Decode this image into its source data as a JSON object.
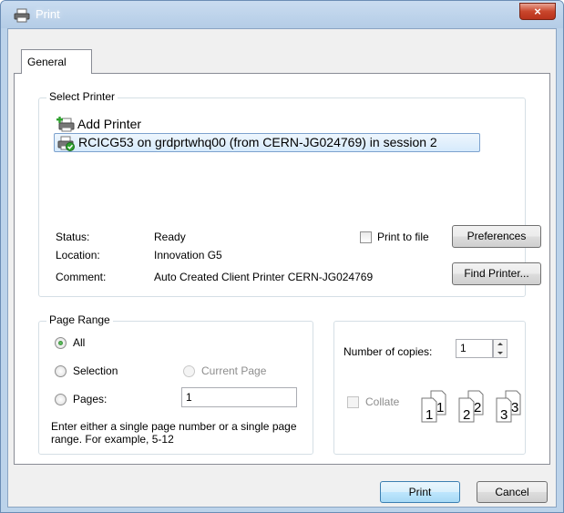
{
  "window": {
    "title": "Print",
    "close_glyph": "×"
  },
  "tabs": [
    {
      "label": "General"
    }
  ],
  "select_printer": {
    "title": "Select Printer",
    "printers": [
      {
        "label": "Add Printer",
        "icon": "add-printer-icon"
      },
      {
        "label": "RCICG53 on grdprtwhq00 (from CERN-JG024769) in session 2",
        "icon": "network-printer-icon",
        "selected": true
      }
    ],
    "status_label": "Status:",
    "status_value": "Ready",
    "location_label": "Location:",
    "location_value": "Innovation G5",
    "comment_label": "Comment:",
    "comment_value": "Auto Created Client Printer CERN-JG024769",
    "print_to_file_label": "Print to file",
    "print_to_file_checked": false,
    "preferences_label": "Preferences",
    "find_printer_label": "Find Printer..."
  },
  "page_range": {
    "title": "Page Range",
    "all_label": "All",
    "selection_label": "Selection",
    "current_page_label": "Current Page",
    "pages_label": "Pages:",
    "pages_value": "1",
    "hint": "Enter either a single page number or a single page range.  For example, 5-12",
    "selected": "all"
  },
  "copies": {
    "label": "Number of copies:",
    "value": "1",
    "collate_label": "Collate",
    "collate_checked": false,
    "collate_pages": [
      "1",
      "1",
      "2",
      "2",
      "3",
      "3"
    ]
  },
  "buttons": {
    "print": "Print",
    "cancel": "Cancel"
  },
  "colors": {
    "title_bar": "#b9d1ea",
    "close": "#c7432a",
    "selection": "#d6eafc",
    "default_button": "#3c7fb1"
  }
}
